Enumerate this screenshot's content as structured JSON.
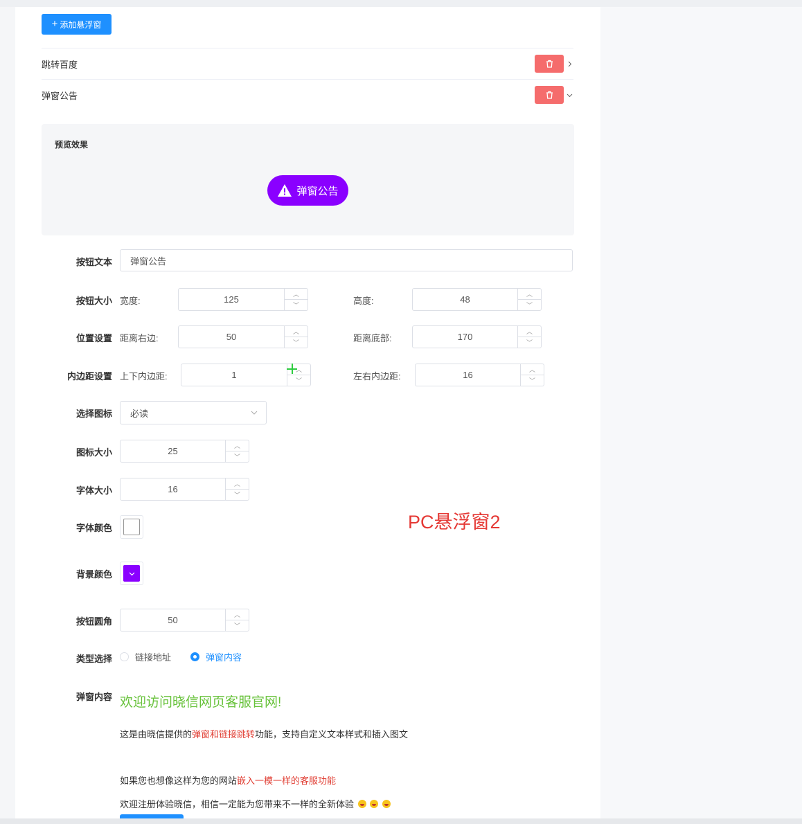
{
  "toolbar": {
    "add_label": "添加悬浮窗"
  },
  "list": [
    {
      "name": "跳转百度",
      "expanded": false
    },
    {
      "name": "弹窗公告",
      "expanded": true
    }
  ],
  "preview": {
    "title": "预览效果",
    "button_text": "弹窗公告",
    "button_bg": "#8a00ff",
    "button_fg": "#ffffff",
    "icon": "warning-triangle-icon"
  },
  "form": {
    "button_text": {
      "label": "按钮文本",
      "value": "弹窗公告"
    },
    "button_size": {
      "label": "按钮大小",
      "width_label": "宽度:",
      "width": "125",
      "height_label": "高度:",
      "height": "48"
    },
    "position": {
      "label": "位置设置",
      "right_label": "距离右边:",
      "right": "50",
      "bottom_label": "距离底部:",
      "bottom": "170"
    },
    "padding": {
      "label": "内边距设置",
      "tb_label": "上下内边距:",
      "tb": "1",
      "lr_label": "左右内边距:",
      "lr": "16"
    },
    "icon": {
      "label": "选择图标",
      "value": "必读"
    },
    "icon_size": {
      "label": "图标大小",
      "value": "25"
    },
    "font_size": {
      "label": "字体大小",
      "value": "16"
    },
    "font_color": {
      "label": "字体颜色",
      "value": "#ffffff"
    },
    "bg_color": {
      "label": "背景颜色",
      "value": "#8a00ff"
    },
    "radius": {
      "label": "按钮圆角",
      "value": "50"
    },
    "type": {
      "label": "类型选择",
      "options": [
        "链接地址",
        "弹窗内容"
      ],
      "selected": "弹窗内容"
    },
    "content": {
      "label": "弹窗内容",
      "title": "欢迎访问晓信网页客服官网!",
      "line1_a": "这是由晓信提供的",
      "line1_b": "弹窗和链接跳转",
      "line1_c": "功能，支持自定义文本样式和插入图文",
      "line2_a": "如果您也想像这样为您的网站",
      "line2_b": "嵌入一模一样的客服功能",
      "line3": "欢迎注册体验晓信，相信一定能为您带来不一样的全新体验"
    }
  },
  "watermark": "PC悬浮窗2"
}
